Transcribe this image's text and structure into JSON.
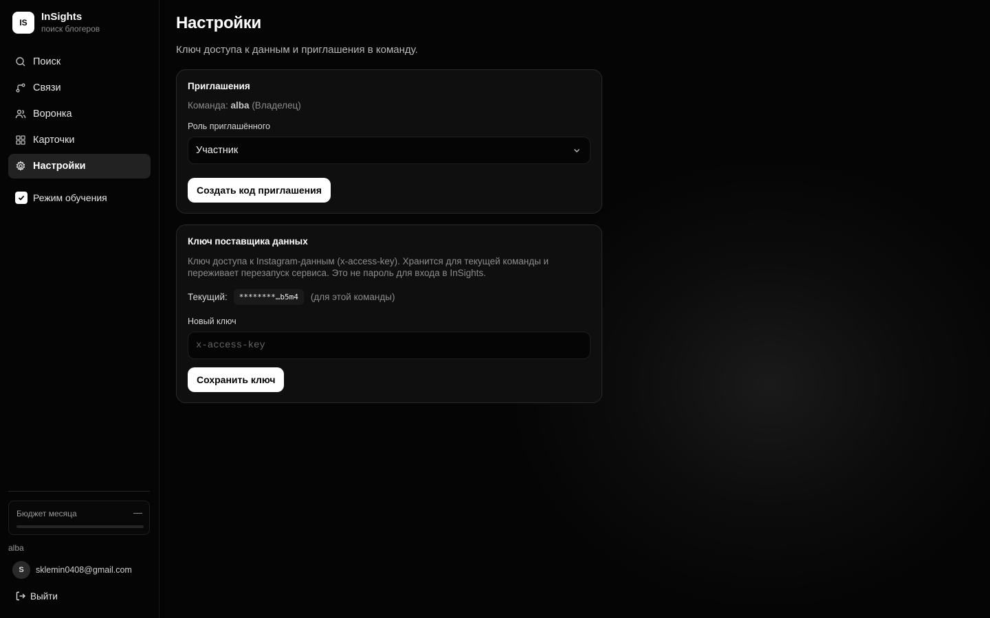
{
  "app": {
    "logo_text": "IS",
    "name": "InSights",
    "tagline": "поиск блогеров"
  },
  "nav": [
    {
      "label": "Поиск",
      "icon": "search-icon",
      "active": false
    },
    {
      "label": "Связи",
      "icon": "connections-icon",
      "active": false
    },
    {
      "label": "Воронка",
      "icon": "users-icon",
      "active": false
    },
    {
      "label": "Карточки",
      "icon": "grid-icon",
      "active": false
    },
    {
      "label": "Настройки",
      "icon": "gear-icon",
      "active": true
    }
  ],
  "training_mode": {
    "label": "Режим обучения",
    "checked": true
  },
  "budget": {
    "label": "Бюджет месяца",
    "value": "—",
    "progress": 0
  },
  "account": {
    "team": "alba",
    "avatar_letter": "S",
    "email": "sklemin0408@gmail.com",
    "logout_label": "Выйти"
  },
  "page": {
    "title": "Настройки",
    "subtitle": "Ключ доступа к данным и приглашения в команду."
  },
  "invitations": {
    "title": "Приглашения",
    "team_prefix": "Команда:",
    "team_name": "alba",
    "team_role": "(Владелец)",
    "role_label": "Роль приглашённого",
    "role_value": "Участник",
    "create_button": "Создать код приглашения"
  },
  "provider_key": {
    "title": "Ключ поставщика данных",
    "description": "Ключ доступа к Instagram-данным (x-access-key). Хранится для текущей команды и переживает перезапуск сервиса. Это не пароль для входа в InSights.",
    "current_label": "Текущий:",
    "current_value": "********…b5m4",
    "current_note": "(для этой команды)",
    "new_key_label": "Новый ключ",
    "new_key_placeholder": "x-access-key",
    "new_key_value": "",
    "save_button": "Сохранить ключ"
  },
  "colors": {
    "background": "#000000",
    "card": "#0f0f0f",
    "accent_button": "#ffffff",
    "active_nav": "#222222"
  }
}
